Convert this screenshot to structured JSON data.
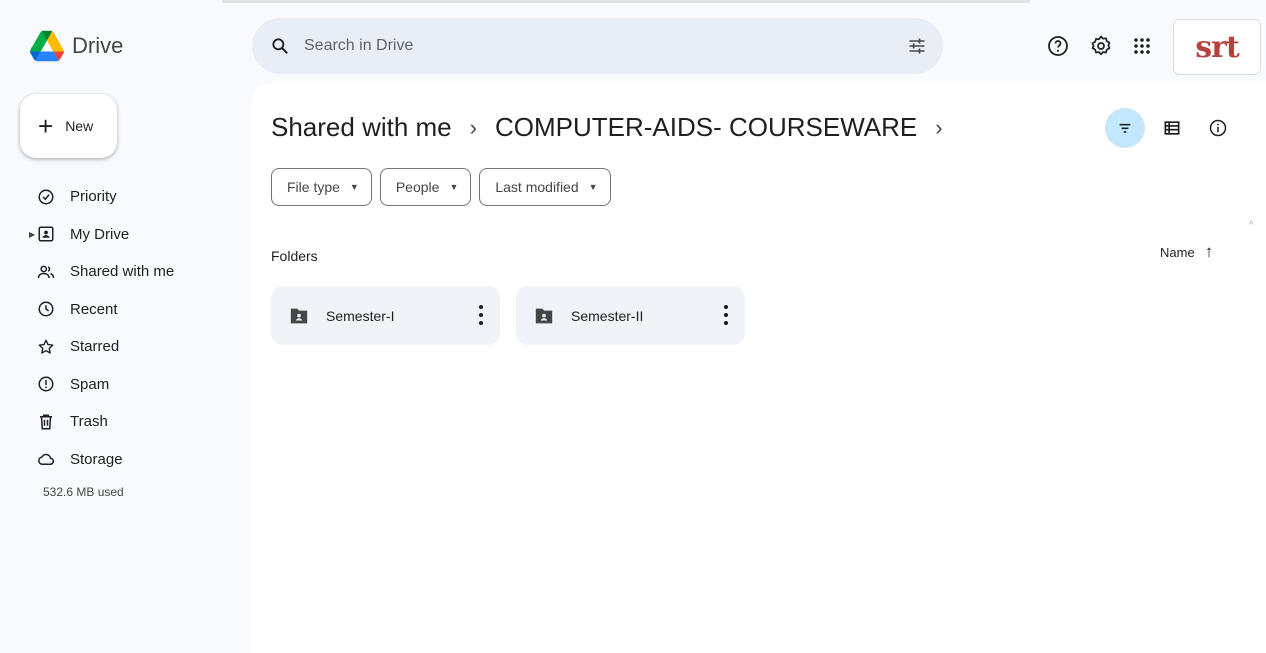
{
  "app": {
    "name": "Drive",
    "logo_icon": "google-drive-logo-icon"
  },
  "search": {
    "placeholder": "Search in Drive",
    "icon": "search-icon",
    "options_icon": "tune-icon"
  },
  "header": {
    "icons": [
      "help-icon",
      "settings-icon",
      "apps-grid-icon"
    ],
    "avatar_text": "srt"
  },
  "sidebar": {
    "new_label": "New",
    "items": [
      {
        "label": "Priority",
        "icon": "priority-check-icon"
      },
      {
        "label": "My Drive",
        "icon": "my-drive-icon"
      },
      {
        "label": "Shared with me",
        "icon": "shared-people-icon"
      },
      {
        "label": "Recent",
        "icon": "clock-icon"
      },
      {
        "label": "Starred",
        "icon": "star-icon"
      },
      {
        "label": "Spam",
        "icon": "spam-icon"
      },
      {
        "label": "Trash",
        "icon": "trash-icon"
      },
      {
        "label": "Storage",
        "icon": "cloud-icon"
      }
    ],
    "storage_used": "532.6 MB used"
  },
  "breadcrumb": {
    "items": [
      "Shared with me",
      "COMPUTER-AIDS- COURSEWARE"
    ]
  },
  "filters": [
    "File type",
    "People",
    "Last modified"
  ],
  "folders": {
    "heading": "Folders",
    "sort_label": "Name",
    "items": [
      {
        "name": "Semester-I"
      },
      {
        "name": "Semester-II"
      }
    ]
  },
  "colors": {
    "accent": "#c2e7ff",
    "background": "#f8fafd",
    "search_bg": "#e9eef6",
    "folder_bg": "#f0f4f9"
  }
}
